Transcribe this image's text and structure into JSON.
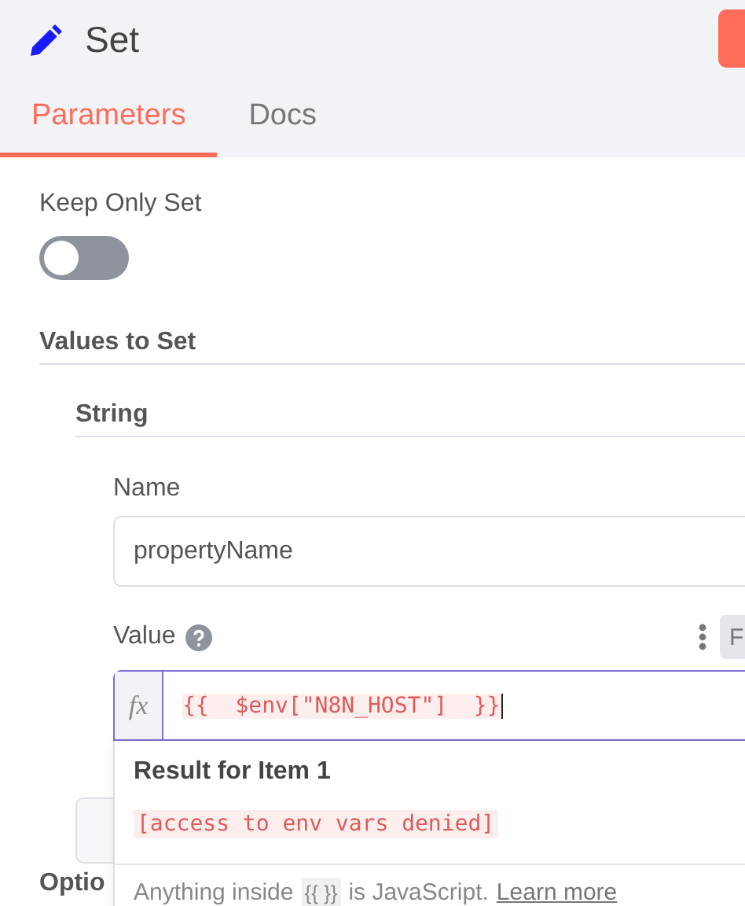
{
  "node": {
    "title": "Set"
  },
  "tabs": [
    {
      "label": "Parameters",
      "selected": true
    },
    {
      "label": "Docs",
      "selected": false
    }
  ],
  "keep_only_set": {
    "label": "Keep Only Set",
    "on": false
  },
  "values_to_set": {
    "label": "Values to Set",
    "groups": [
      {
        "label": "String",
        "fields": [
          {
            "kind": "text",
            "label": "Name",
            "value": "propertyName"
          },
          {
            "kind": "expression",
            "label": "Value",
            "help": true,
            "fx": "fx",
            "expression": "{{  $env[\"N8N_HOST\"]  }}",
            "side_button": "F"
          }
        ]
      }
    ]
  },
  "result_popup": {
    "title": "Result for Item 1",
    "result": "[access to env vars denied]",
    "hint_before": "Anything inside",
    "hint_code": "{{ }}",
    "hint_after": "is JavaScript.",
    "link": "Learn more"
  },
  "options_label": "Optio"
}
